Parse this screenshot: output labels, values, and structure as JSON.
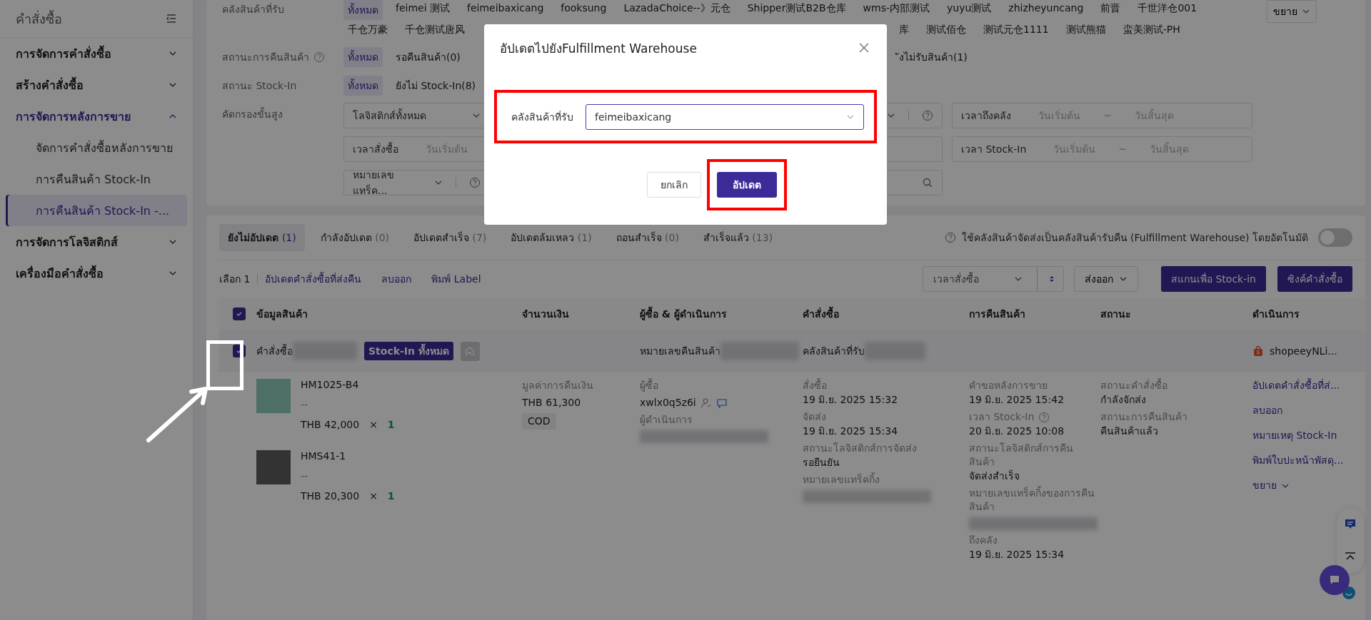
{
  "sidebar": {
    "title": "คำสั่งซื้อ",
    "groups": [
      {
        "label": "การจัดการคำสั่งซื้อ",
        "active": false,
        "expanded": false
      },
      {
        "label": "สร้างคำสั่งซื้อ",
        "active": false,
        "expanded": false
      },
      {
        "label": "การจัดการหลังการขาย",
        "active": true,
        "expanded": true,
        "children": [
          {
            "label": "จัดการคำสั่งซื้อหลังการขาย",
            "selected": false
          },
          {
            "label": "การคืนสินค้า Stock-In",
            "selected": false
          },
          {
            "label": "การคืนสินค้า Stock-In -...",
            "selected": true
          }
        ]
      },
      {
        "label": "การจัดการโลจิสติกส์",
        "active": false,
        "expanded": false
      },
      {
        "label": "เครื่องมือคำสั่งซื้อ",
        "active": false,
        "expanded": false
      }
    ]
  },
  "filters": [
    {
      "label": "คลังสินค้าที่รับ",
      "expand_button": "ขยาย",
      "lines": [
        {
          "options": [
            {
              "label": "ทั้งหมด",
              "selected": true
            },
            {
              "label": "feimei 测试",
              "selected": false
            },
            {
              "label": "feimeibaxicang",
              "selected": false
            },
            {
              "label": "fooksung",
              "selected": false
            },
            {
              "label": "LazadaChoice--》元仓",
              "selected": false
            },
            {
              "label": "Shipper测试B2B仓库",
              "selected": false
            },
            {
              "label": "wms-内部测试",
              "selected": false
            },
            {
              "label": "yuyu测试",
              "selected": false
            },
            {
              "label": "zhizheyuncang",
              "selected": false
            },
            {
              "label": "前晋",
              "selected": false
            },
            {
              "label": "千世洋仓001",
              "selected": false
            }
          ]
        },
        {
          "options": [
            {
              "label": "千仓万豪",
              "selected": false
            },
            {
              "label": "千仓测试唐风",
              "selected": false
            }
          ],
          "more_options": [
            {
              "label": "库",
              "selected": false
            },
            {
              "label": "测试佰仓",
              "selected": false
            },
            {
              "label": "测试元仓1111",
              "selected": false
            },
            {
              "label": "测试熊猫",
              "selected": false
            },
            {
              "label": "蛮美测试-PH",
              "selected": false
            }
          ]
        }
      ]
    },
    {
      "label": "สถานะการคืนสินค้า",
      "help": true,
      "lines": [
        {
          "options": [
            {
              "label": "ทั้งหมด",
              "selected": true
            },
            {
              "label": "รอคืนสินค้า(0)",
              "selected": false
            }
          ],
          "more_options": [
            {
              "label": "ังไม่รับสินค้า(1)",
              "selected": false
            }
          ]
        }
      ]
    },
    {
      "label": "สถานะ Stock-In",
      "lines": [
        {
          "options": [
            {
              "label": "ทั้งหมด",
              "selected": true
            },
            {
              "label": "ยังไม่ Stock-In(8)",
              "selected": false
            }
          ]
        }
      ]
    }
  ],
  "advanced": {
    "label": "คัดกรองขั้นสูง",
    "controls": [
      {
        "kind": "select",
        "value": "โลจิสติกส์ทั้งหมด"
      },
      {
        "kind": "select",
        "help": true
      },
      {
        "kind": "date-range",
        "label": "เวลาถึงคลัง",
        "start": "วันเริ่มต้น",
        "separator": "~",
        "end": "วันสิ้นสุด"
      },
      {
        "kind": "date-start",
        "label": "เวลาสั่งซื้อ",
        "start": "วันเริ่มต้น"
      },
      {
        "kind": "date-range",
        "label": "เวลา Stock-In",
        "start": "วันเริ่มต้น",
        "separator": "~",
        "end": "วันสิ้นสุด"
      },
      {
        "kind": "select",
        "value": "หมายเลขแทร็ค...",
        "help": true
      },
      {
        "kind": "search"
      }
    ]
  },
  "tabs": [
    {
      "label": "ยังไม่อัปเดต",
      "count": "(1)",
      "selected": true
    },
    {
      "label": "กำลังอัปเดต",
      "count": "(0)",
      "selected": false
    },
    {
      "label": "อัปเดตสำเร็จ",
      "count": "(7)",
      "selected": false
    },
    {
      "label": "อัปเดตล้มเหลว",
      "count": "(1)",
      "selected": false
    },
    {
      "label": "ถอนสำเร็จ",
      "count": "(0)",
      "selected": false
    },
    {
      "label": "สำเร็จแล้ว",
      "count": "(13)",
      "selected": false
    }
  ],
  "auto_setting": {
    "text": "ใช้คลังสินค้าจัดส่งเป็นคลังสินค้ารับคืน (Fulfillment Warehouse) โดยอัตโนมัติ",
    "on": false
  },
  "toolbar": {
    "selection": "เลือก 1",
    "links": [
      "อัปเดตคำสั่งซื้อที่ส่งคืน",
      "ลบออก",
      "พิมพ์ Label"
    ],
    "sort": "เวลาสั่งซื้อ",
    "export": "ส่งออก",
    "buttons": [
      "สแกนเพื่อ Stock-in",
      "ซิงค์คำสั่งซื้อ"
    ]
  },
  "table": {
    "all_checked": true,
    "columns": [
      "ข้อมูลสินค้า",
      "จำนวนเงิน",
      "ผู้ซื้อ & ผู้ดำเนินการ",
      "คำสั่งซื้อ",
      "การคืนสินค้า",
      "สถานะ",
      "ดำเนินการ"
    ],
    "orders": [
      {
        "checked": true,
        "order_label": "คำสั่งซื้อ",
        "badge": "Stock-In ทั้งหมด",
        "return_label": "หมายเลขคืนสินค้า",
        "warehouse_label": "คลังสินค้าที่รับ",
        "shop": "shopeeyNLi...",
        "items": [
          {
            "sku": "HM1025-B4",
            "variant": "--",
            "price": "THB 42,000",
            "times": "×",
            "qty": "1"
          },
          {
            "sku": "HMS41-1",
            "variant": "--",
            "price": "THB 20,300",
            "times": "×",
            "qty": "1"
          }
        ],
        "amount": {
          "label": "มูลค่าการคืนเงิน",
          "value": "THB 61,300",
          "tag": "COD"
        },
        "buyer": {
          "label": "ผู้ซื้อ",
          "name": "xwlx0q5z6i",
          "operator_label": "ผู้ดำเนินการ"
        },
        "order_info": [
          {
            "label": "สั่งซื้อ",
            "value": "19 มิ.ย. 2025 15:32"
          },
          {
            "label": "จัดส่ง",
            "value": "19 มิ.ย. 2025 15:34"
          },
          {
            "label": "สถานะโลจิสติกส์การจัดส่ง",
            "value": "รอยืนยัน"
          },
          {
            "label": "หมายเลขแทร็คกิ้ง"
          }
        ],
        "return_info": [
          {
            "label": "คำขอหลังการขาย",
            "value": "19 มิ.ย. 2025 15:42"
          },
          {
            "label": "เวลา Stock-In",
            "value": "20 มิ.ย. 2025 10:08",
            "help": true
          },
          {
            "label": "สถานะโลจิสติกส์การคืนสินค้า",
            "value": "จัดส่งสำเร็จ"
          },
          {
            "label": "หมายเลขแทร็คกิ้งของการคืนสินค้า"
          },
          {
            "label": "ถึงคลัง",
            "value": "19 มิ.ย. 2025 15:34"
          }
        ],
        "status_info": [
          {
            "label": "สถานะคำสั่งซื้อ",
            "value": "กำลังจักส่ง"
          },
          {
            "label": "สถานะการคืนสินค้า",
            "value": "คืนสินค้าแล้ว"
          }
        ],
        "actions": [
          "อัปเดตคำสั่งซื้อที่ส่...",
          "ลบออก",
          "หมายเหตุ Stock-In",
          "พิมพ์ใบปะหน้าพัสดุ..."
        ],
        "more": "ขยาย"
      }
    ]
  },
  "dialog": {
    "title": "อัปเดตไปยังFulfillment Warehouse",
    "field_label": "คลังสินค้าที่รับ",
    "value": "feimeibaxicang",
    "cancel": "ยกเลิก",
    "confirm": "อัปเดต"
  }
}
